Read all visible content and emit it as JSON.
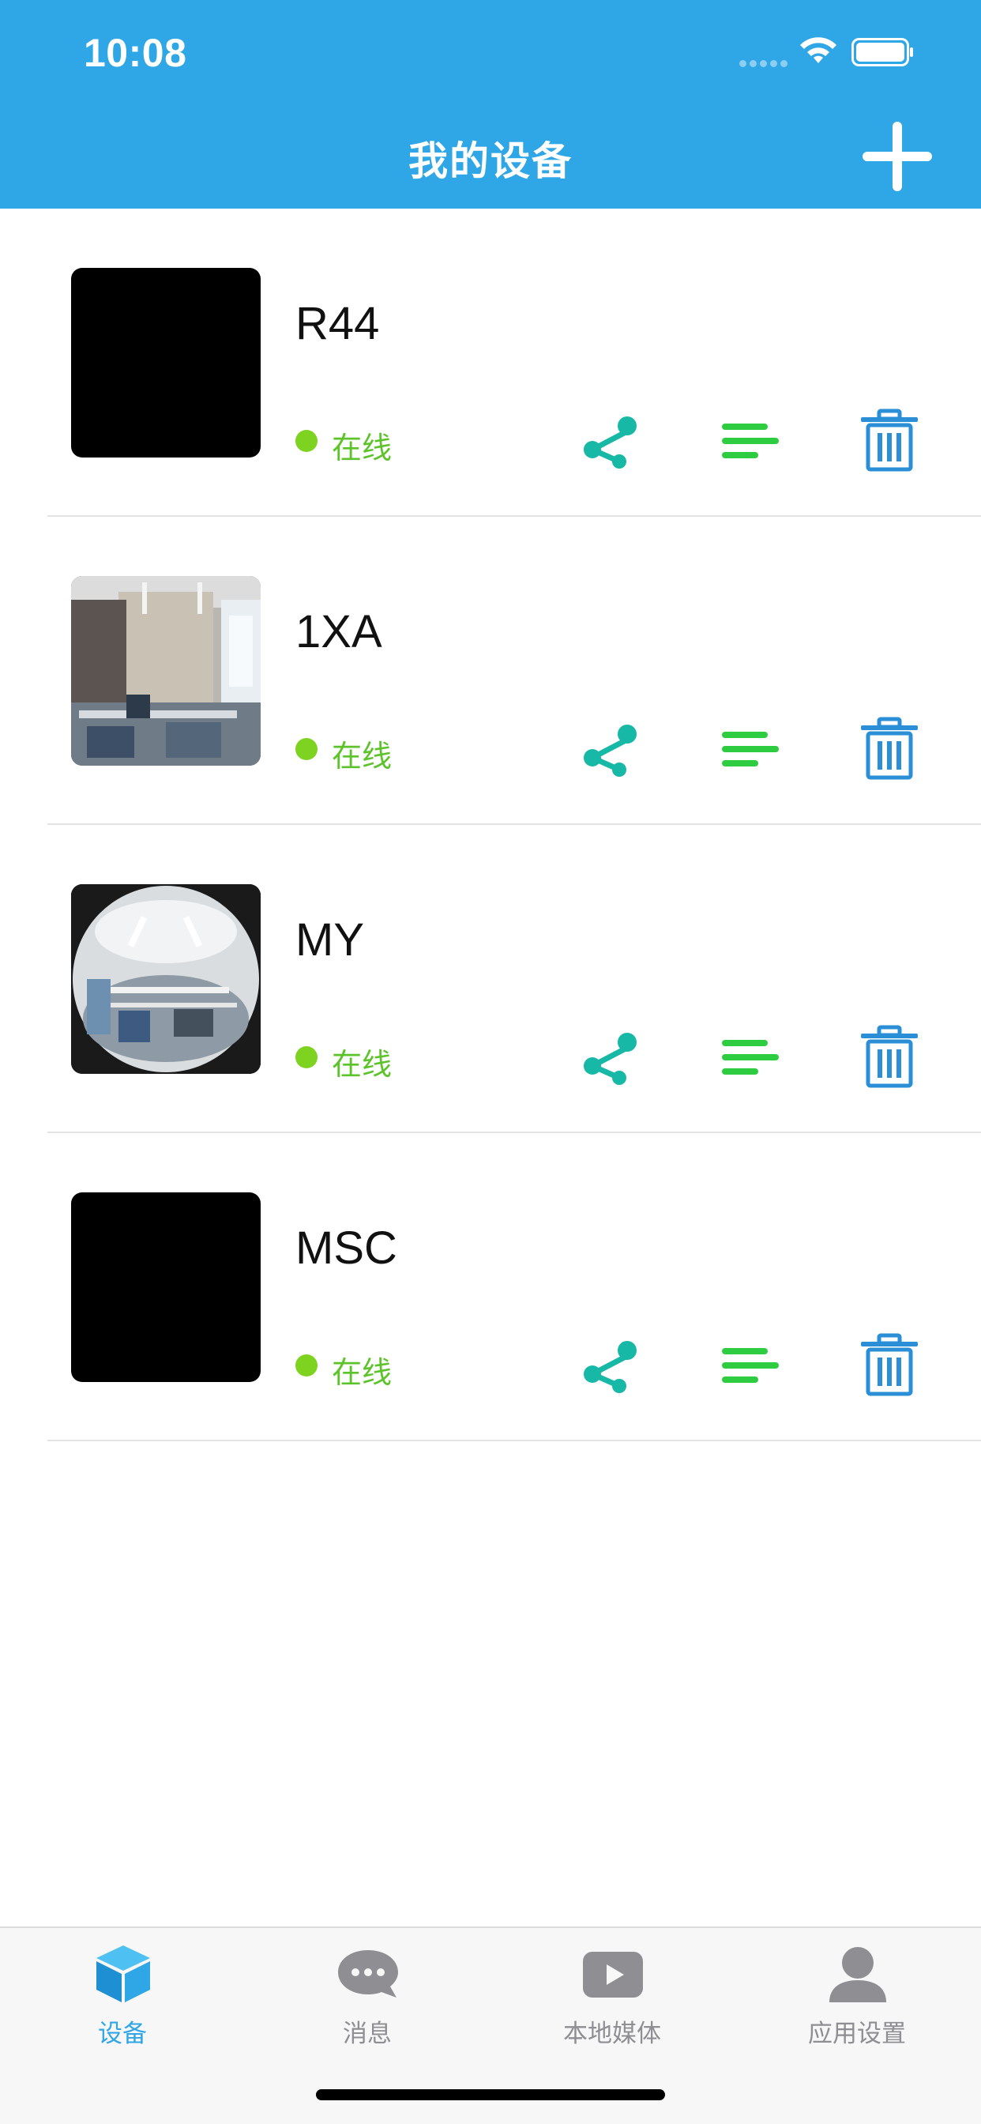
{
  "status_bar": {
    "time": "10:08"
  },
  "header": {
    "title": "我的设备",
    "add_icon": "plus-icon"
  },
  "colors": {
    "header_bg": "#2fa6e6",
    "online_dot": "#7ed321",
    "online_text": "#5dc32a",
    "share_icon": "#17b8a6",
    "menu_icon": "#2ecc40",
    "delete_icon": "#2a8fd6",
    "tab_active": "#2fa6e6",
    "tab_inactive": "#8e8e93"
  },
  "devices": [
    {
      "name": "R44",
      "status": "在线",
      "thumbnail": "black-thumbnail"
    },
    {
      "name": "1XA",
      "status": "在线",
      "thumbnail": "camera-snapshot-office"
    },
    {
      "name": "MY",
      "status": "在线",
      "thumbnail": "camera-snapshot-fisheye"
    },
    {
      "name": "MSC",
      "status": "在线",
      "thumbnail": "black-thumbnail"
    }
  ],
  "row_icons": {
    "share": "share-icon",
    "menu": "list-icon",
    "delete": "trash-icon"
  },
  "tabs": [
    {
      "label": "设备",
      "icon": "cube-icon",
      "active": true
    },
    {
      "label": "消息",
      "icon": "chat-bubble-icon",
      "active": false
    },
    {
      "label": "本地媒体",
      "icon": "play-icon",
      "active": false
    },
    {
      "label": "应用设置",
      "icon": "person-icon",
      "active": false
    }
  ]
}
